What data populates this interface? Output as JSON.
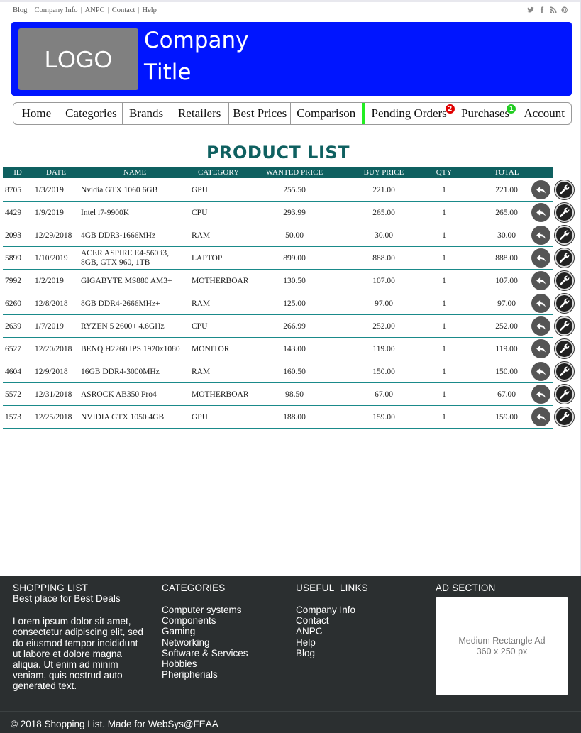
{
  "topbar": {
    "links": [
      "Blog",
      "Company Info",
      "ANPC",
      "Contact",
      "Help"
    ],
    "social_icons": [
      "twitter-icon",
      "facebook-icon",
      "rss-icon",
      "pinterest-icon"
    ]
  },
  "header": {
    "logo_text": "LOGO",
    "title_line1": "Company",
    "title_line2": "Title",
    "bg_color": "#0015ff"
  },
  "nav": {
    "items": [
      "Home",
      "Categories",
      "Brands",
      "Retailers",
      "Best Prices",
      "Comparison",
      "Pending Orders",
      "Purchases",
      "Account"
    ],
    "pending_badge": "2",
    "purchases_badge": "1",
    "pending_badge_color": "#e00000",
    "purchases_badge_color": "#22cc22"
  },
  "product_list": {
    "title": "PRODUCT LIST",
    "columns": [
      "ID",
      "DATE",
      "NAME",
      "CATEGORY",
      "WANTED PRICE",
      "BUY PRICE",
      "QTY",
      "TOTAL"
    ],
    "accent_color": "#0f6060",
    "rows": [
      {
        "id": "8705",
        "date": "1/3/2019",
        "name": "Nvidia GTX 1060 6GB",
        "category": "GPU",
        "wanted": "255.50",
        "buy": "221.00",
        "qty": "1",
        "total": "221.00"
      },
      {
        "id": "4429",
        "date": "1/9/2019",
        "name": "Intel i7-9900K",
        "category": "CPU",
        "wanted": "293.99",
        "buy": "265.00",
        "qty": "1",
        "total": "265.00"
      },
      {
        "id": "2093",
        "date": "12/29/2018",
        "name": "4GB DDR3-1666MHz",
        "category": "RAM",
        "wanted": "50.00",
        "buy": "30.00",
        "qty": "1",
        "total": "30.00"
      },
      {
        "id": "5899",
        "date": "1/10/2019",
        "name": "ACER ASPIRE E4-560 i3, 8GB, GTX 960, 1TB",
        "category": "LAPTOP",
        "wanted": "899.00",
        "buy": "888.00",
        "qty": "1",
        "total": "888.00"
      },
      {
        "id": "7992",
        "date": "1/2/2019",
        "name": "GIGABYTE MS880 AM3+",
        "category": "MOTHERBOARD",
        "wanted": "130.50",
        "buy": "107.00",
        "qty": "1",
        "total": "107.00"
      },
      {
        "id": "6260",
        "date": "12/8/2018",
        "name": "8GB DDR4-2666MHz+",
        "category": "RAM",
        "wanted": "125.00",
        "buy": "97.00",
        "qty": "1",
        "total": "97.00"
      },
      {
        "id": "2639",
        "date": "1/7/2019",
        "name": "RYZEN 5 2600+ 4.6GHz",
        "category": "CPU",
        "wanted": "266.99",
        "buy": "252.00",
        "qty": "1",
        "total": "252.00"
      },
      {
        "id": "6527",
        "date": "12/20/2018",
        "name": "BENQ H2260 IPS 1920x1080",
        "category": "MONITOR",
        "wanted": "143.00",
        "buy": "119.00",
        "qty": "1",
        "total": "119.00"
      },
      {
        "id": "4604",
        "date": "12/9/2018",
        "name": "16GB DDR4-3000MHz",
        "category": "RAM",
        "wanted": "160.50",
        "buy": "150.00",
        "qty": "1",
        "total": "150.00"
      },
      {
        "id": "5572",
        "date": "12/31/2018",
        "name": "ASROCK AB350 Pro4",
        "category": "MOTHERBOARD",
        "wanted": "98.50",
        "buy": "67.00",
        "qty": "1",
        "total": "67.00"
      },
      {
        "id": "1573",
        "date": "12/25/2018",
        "name": "NVIDIA GTX 1050 4GB",
        "category": "GPU",
        "wanted": "188.00",
        "buy": "159.00",
        "qty": "1",
        "total": "159.00"
      }
    ]
  },
  "footer": {
    "about_title": "SHOPPING LIST",
    "about_subtitle": "Best place for Best Deals",
    "about_text": "Lorem ipsum dolor sit amet, consectetur adipiscing elit, sed do eiusmod tempor incididunt ut labore et dolore magna aliqua. Ut enim ad minim veniam, quis nostrud auto generated text.",
    "categories_title": "CATEGORIES",
    "categories": [
      "Computer systems",
      "Components",
      "Gaming",
      "Networking",
      "Software & Services",
      "Hobbies",
      "Pheripherials"
    ],
    "links_title": "USEFUL  LINKS",
    "links": [
      "Company Info",
      "Contact",
      "ANPC",
      "Help",
      "Blog"
    ],
    "ad_title": "AD SECTION",
    "ad_line1": "Medium Rectangle Ad",
    "ad_line2": "360 x 250 px",
    "copyright": "© 2018 Shopping List. Made for WebSys@FEAA",
    "bg_color": "#2b2f30"
  }
}
